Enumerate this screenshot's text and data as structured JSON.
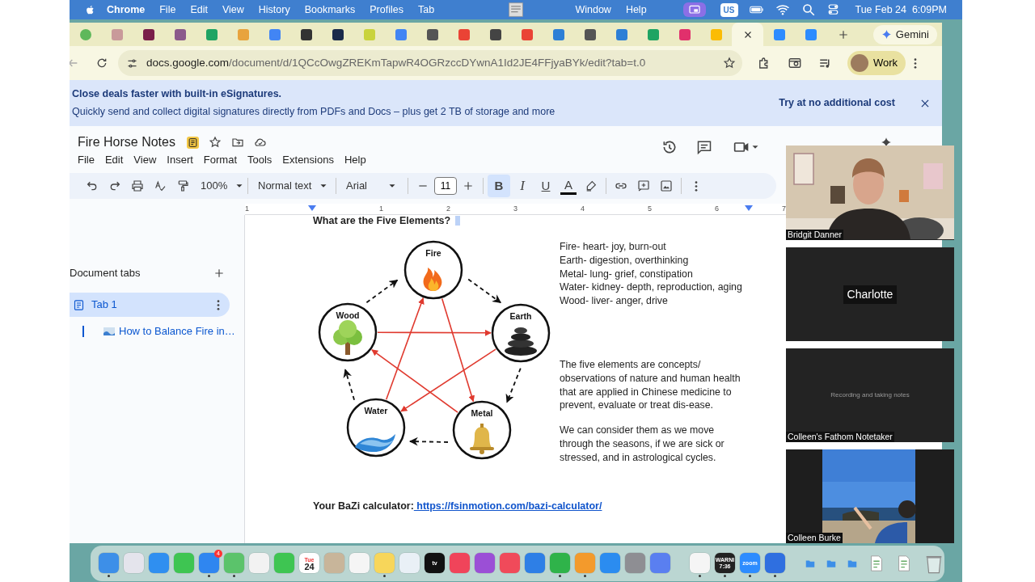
{
  "menu_bar": {
    "app": "Chrome",
    "items": [
      "File",
      "Edit",
      "View",
      "History",
      "Bookmarks",
      "Profiles",
      "Tab"
    ],
    "right_items": [
      "Window",
      "Help"
    ],
    "input_source": "US",
    "clock": "Tue Feb 24  6:09PM"
  },
  "browser": {
    "tabs": [
      {
        "color": "#5fb85b",
        "selected": false
      },
      {
        "color": "#c99a9a",
        "selected": false
      },
      {
        "color": "#7a1f4a",
        "selected": false
      },
      {
        "color": "#8b5a8b",
        "selected": false
      },
      {
        "color": "#1fa463",
        "selected": false
      },
      {
        "color": "#e8a33d",
        "selected": false
      },
      {
        "color": "#4285f4",
        "selected": false
      },
      {
        "color": "#333333",
        "selected": false
      },
      {
        "color": "#1a2a4a",
        "selected": false
      },
      {
        "color": "#c9d33c",
        "selected": false
      },
      {
        "color": "#4285f4",
        "selected": false
      },
      {
        "color": "#555555",
        "selected": false
      },
      {
        "color": "#ea4335",
        "selected": false
      },
      {
        "color": "#444444",
        "selected": false
      },
      {
        "color": "#ea4335",
        "selected": false
      },
      {
        "color": "#2d7fd6",
        "selected": false
      },
      {
        "color": "#555555",
        "selected": false
      },
      {
        "color": "#2d7fd6",
        "selected": false
      },
      {
        "color": "#1fa463",
        "selected": false
      },
      {
        "color": "#e1306c",
        "selected": false
      },
      {
        "color": "#fbbc04",
        "selected": false
      },
      {
        "selected": true
      },
      {
        "color": "#2d8cff",
        "selected": false
      },
      {
        "color": "#2d8cff",
        "selected": false
      }
    ],
    "gemini": "Gemini",
    "address": {
      "host": "docs.google.com",
      "path": "/document/d/1QCcOwgZREKmTapwR4OGRzccDYwnA1Id2JE4FFjyaBYk/edit?tab=t.0"
    },
    "profile": "Work"
  },
  "banner": {
    "title": "Close deals faster with built-in eSignatures.",
    "text": "Quickly send and collect digital signatures directly from PDFs and Docs – plus get 2 TB of storage and more",
    "action": "Try at no additional cost"
  },
  "document": {
    "title": "Fire Horse Notes",
    "menus": [
      "File",
      "Edit",
      "View",
      "Insert",
      "Format",
      "Tools",
      "Extensions",
      "Help"
    ],
    "toolbar": {
      "zoom": "100%",
      "style": "Normal text",
      "font": "Arial",
      "font_size": "11",
      "format_buttons": [
        {
          "label": "B",
          "kind": "bold",
          "selected": true
        },
        {
          "label": "I",
          "kind": "italic",
          "selected": false
        },
        {
          "label": "U",
          "kind": "underline",
          "selected": false
        },
        {
          "label": "A",
          "kind": "color",
          "selected": false
        }
      ]
    },
    "ruler": {
      "left_label": "1",
      "labels": [
        "1",
        "2",
        "3",
        "4",
        "5",
        "6",
        "7"
      ]
    }
  },
  "sidebar": {
    "heading": "Document tabs",
    "tabs": [
      {
        "label": "Tab 1",
        "selected": true,
        "children": [
          {
            "label": "How to Balance Fire in…",
            "selected": true
          }
        ]
      }
    ]
  },
  "page": {
    "heading": "What are the Five Elements?",
    "diagram": {
      "elements": [
        {
          "label": "Fire",
          "kind": "fire"
        },
        {
          "label": "Earth",
          "kind": "earth"
        },
        {
          "label": "Metal",
          "kind": "metal"
        },
        {
          "label": "Water",
          "kind": "water"
        },
        {
          "label": "Wood",
          "kind": "wood"
        }
      ]
    },
    "correspondences": [
      "Fire- heart- joy, burn-out",
      "Earth- digestion, overthinking",
      "Metal- lung- grief, constipation",
      "Water- kidney- depth, reproduction, aging",
      "Wood- liver- anger, drive"
    ],
    "paragraphs": [
      "The five elements are concepts/ observations of nature and human health that are applied in Chinese medicine to prevent, evaluate or treat dis-ease.",
      "We can consider them as we move through the seasons, if we are sick or stressed, and in astrological cycles."
    ],
    "calculator": {
      "label": "Your BaZi calculator:",
      "link": " https://fsinmotion.com/bazi-calculator/"
    }
  },
  "participants": [
    {
      "name": "Bridgit Danner",
      "kind": "camera"
    },
    {
      "name": "Charlotte",
      "kind": "name_only"
    },
    {
      "name": "Colleen's Fathom Notetaker",
      "kind": "notetaker",
      "message": "Recording and taking notes"
    },
    {
      "name": "Colleen Burke",
      "kind": "camera"
    }
  ],
  "dock": {
    "apps": [
      {
        "color": "#3d8fe8",
        "running": true
      },
      {
        "color": "#e4e4ec",
        "running": false
      },
      {
        "color": "#2f8ff0",
        "running": false
      },
      {
        "color": "#3ec552",
        "running": false
      },
      {
        "color": "#2f86f0",
        "running": true,
        "badge": "4"
      },
      {
        "color": "#5bc36b",
        "running": true
      },
      {
        "color": "#f2f2f2",
        "running": false
      },
      {
        "color": "#3ec552",
        "running": false
      },
      {
        "color": "#ffffff",
        "running": false,
        "labels": [
          "Tue",
          "24"
        ]
      },
      {
        "color": "#c8b59a",
        "running": false
      },
      {
        "color": "#f5f5f5",
        "running": false
      },
      {
        "color": "#f7d65a",
        "running": true
      },
      {
        "color": "#e9f0f6",
        "running": false
      },
      {
        "color": "#111111",
        "running": false,
        "labels": [
          "tv"
        ]
      },
      {
        "color": "#f0445a",
        "running": false
      },
      {
        "color": "#9b4fd6",
        "running": false
      },
      {
        "color": "#f04a5a",
        "running": false
      },
      {
        "color": "#2e7fe6",
        "running": false
      },
      {
        "color": "#2fb34a",
        "running": true
      },
      {
        "color": "#f39a2c",
        "running": true
      },
      {
        "color": "#2b8cf0",
        "running": false
      },
      {
        "color": "#8e8e93",
        "running": false
      },
      {
        "color": "#5a7ff0",
        "running": false
      }
    ],
    "recent": [
      {
        "color": "#f5f5f5",
        "running": true
      },
      {
        "color": "#222222",
        "running": true,
        "labels": [
          "WARNI",
          "7:36"
        ]
      },
      {
        "color": "#2d8cff",
        "running": true,
        "labels": [
          "zoom"
        ]
      },
      {
        "color": "#2f6fe0",
        "running": true
      }
    ],
    "stacks": [
      {
        "kind": "folder"
      },
      {
        "kind": "folder"
      },
      {
        "kind": "folder"
      },
      {
        "kind": "file"
      },
      {
        "kind": "file"
      },
      {
        "kind": "trash"
      }
    ]
  }
}
